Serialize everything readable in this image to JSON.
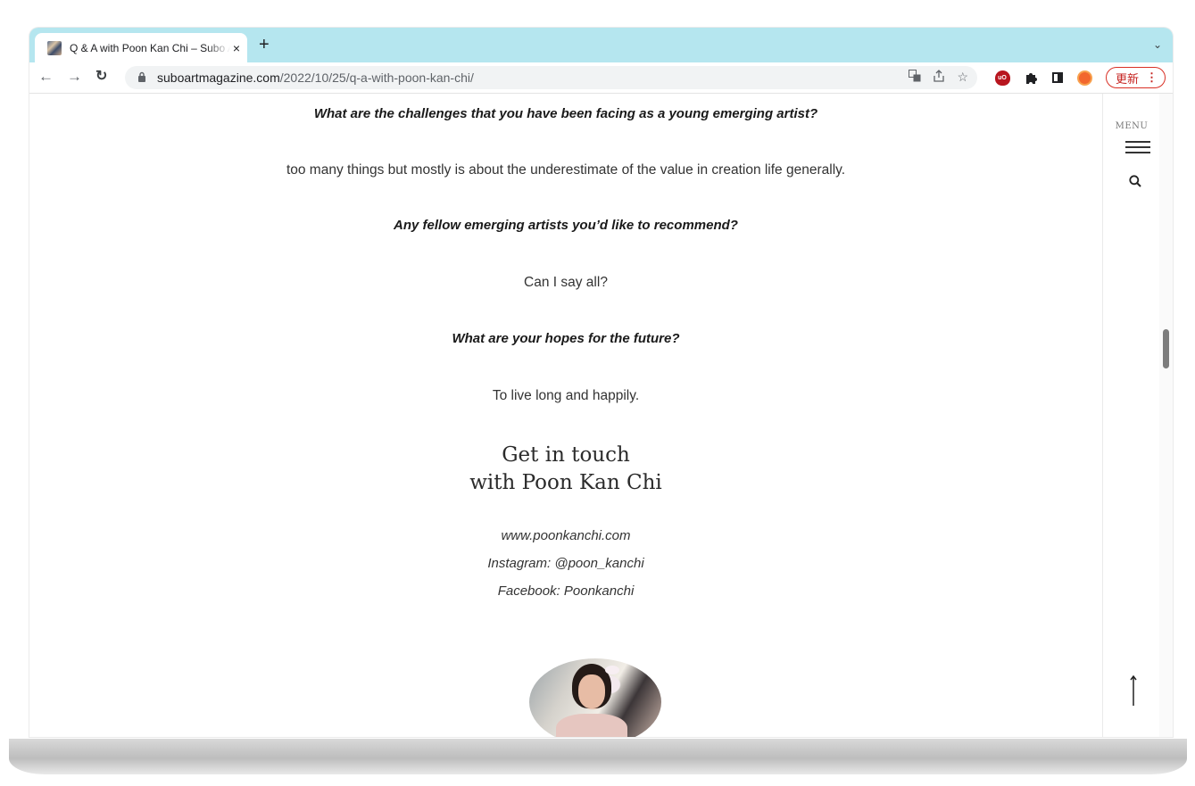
{
  "browser": {
    "tab_title": "Q & A with Poon Kan Chi – Subo Art Magazine",
    "tab_close": "×",
    "new_tab": "+",
    "tab_dropdown": "⌄",
    "url_host": "suboartmagazine.com",
    "url_path": "/2022/10/25/q-a-with-poon-kan-chi/",
    "update_label": "更新",
    "update_menu": "⋮"
  },
  "article": {
    "q1": "What are the challenges that you have been facing as a young emerging artist?",
    "a1": "too many things but mostly is about the underestimate of the value in creation life generally.",
    "q2": "Any fellow emerging artists you’d like to recommend?",
    "a2": "Can I say all?",
    "q3": "What are your hopes for the future?",
    "a3": "To live long and happily.",
    "touch_line1": "Get in touch",
    "touch_line2": "with Poon Kan Chi",
    "website": "www.poonkanchi.com",
    "instagram": "Instagram: @poon_kanchi",
    "facebook": "Facebook: Poonkanchi"
  },
  "sidebar": {
    "menu_label": "MENU"
  },
  "icons": {
    "back": "back-arrow-icon",
    "forward": "forward-arrow-icon",
    "reload": "reload-icon",
    "lock": "lock-icon",
    "translate": "translate-icon",
    "share": "share-icon",
    "star": "bookmark-star-icon",
    "ublock": "ublock-icon",
    "extensions": "puzzle-icon",
    "side_panel": "side-panel-icon",
    "profile": "profile-avatar-icon",
    "menu": "hamburger-icon",
    "search": "search-icon",
    "top": "arrow-up-icon"
  },
  "colors": {
    "tabstrip": "#b5e6ef",
    "update_red": "#d93025"
  }
}
